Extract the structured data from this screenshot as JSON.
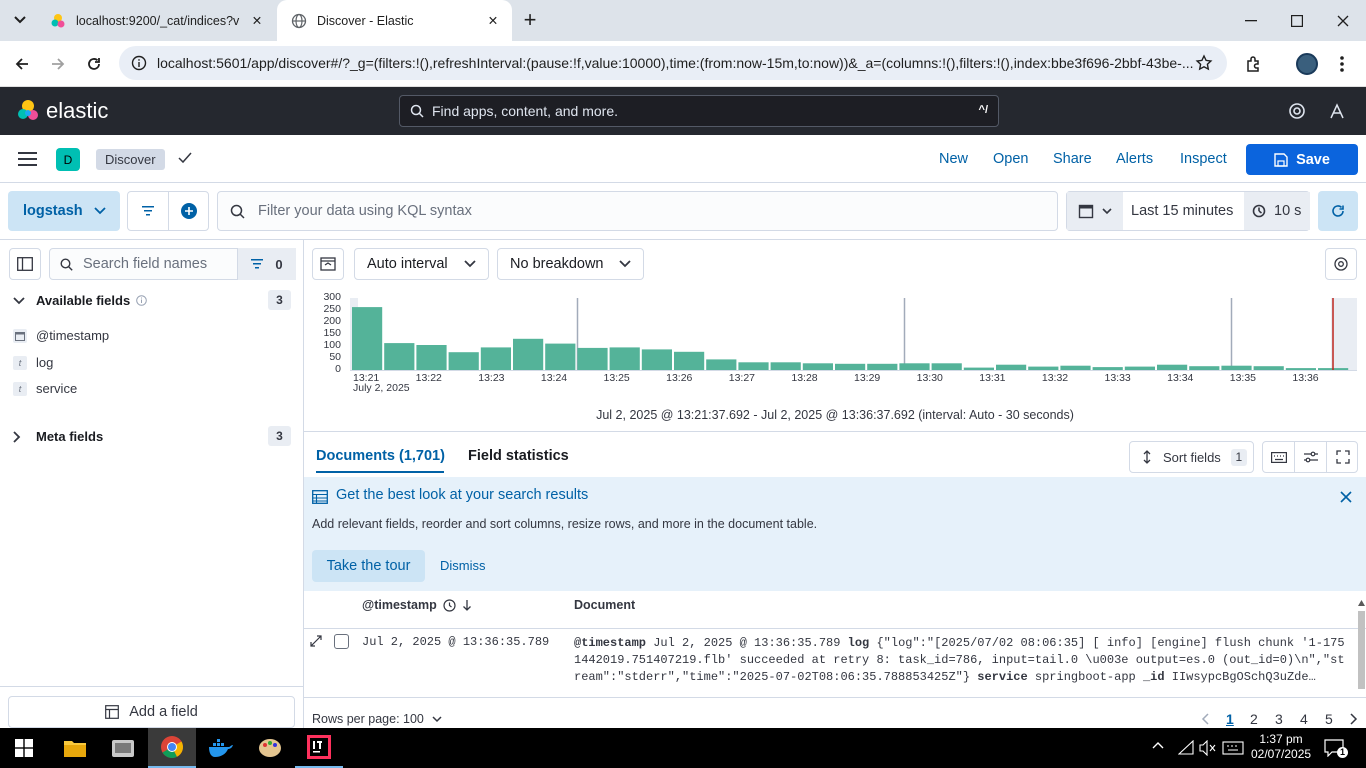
{
  "browser": {
    "tabs": [
      {
        "title": "localhost:9200/_cat/indices?v"
      },
      {
        "title": "Discover - Elastic"
      }
    ],
    "url": "localhost:5601/app/discover#/?_g=(filters:!(),refreshInterval:(pause:!f,value:10000),time:(from:now-15m,to:now))&_a=(columns:!(),filters:!(),index:bbe3f696-2bbf-43be-..."
  },
  "kibana": {
    "brand": "elastic",
    "global_search_placeholder": "Find apps, content, and more.",
    "global_search_shortcut": "^/",
    "space_initial": "D",
    "app_name": "Discover",
    "menu": [
      "New",
      "Open",
      "Share",
      "Alerts",
      "Inspect"
    ],
    "save_label": "Save"
  },
  "query_bar": {
    "data_view": "logstash",
    "kql_placeholder": "Filter your data using KQL syntax",
    "time_range": "Last 15 minutes",
    "refresh_interval": "10 s"
  },
  "sidebar": {
    "search_placeholder": "Search field names",
    "filter_count": "0",
    "available_label": "Available fields",
    "available_count": "3",
    "fields": [
      {
        "name": "@timestamp",
        "type": "date-icon"
      },
      {
        "name": "log",
        "type": "t"
      },
      {
        "name": "service",
        "type": "t"
      }
    ],
    "meta_label": "Meta fields",
    "meta_count": "3",
    "add_field_label": "Add a field"
  },
  "histogram_toolbar": {
    "interval": "Auto interval",
    "breakdown": "No breakdown"
  },
  "chart_data": {
    "type": "bar",
    "x_ticks": [
      "13:21",
      "13:22",
      "13:23",
      "13:24",
      "13:25",
      "13:26",
      "13:27",
      "13:28",
      "13:29",
      "13:30",
      "13:31",
      "13:32",
      "13:33",
      "13:34",
      "13:35",
      "13:36"
    ],
    "x_sublabel": "July 2, 2025",
    "y_ticks": [
      "300",
      "250",
      "200",
      "150",
      "100",
      "50",
      "0"
    ],
    "ylim": [
      0,
      300
    ],
    "values": [
      262,
      112,
      104,
      74,
      94,
      130,
      110,
      92,
      94,
      86,
      76,
      44,
      32,
      32,
      28,
      26,
      26,
      28,
      28,
      10,
      22,
      14,
      18,
      12,
      14,
      22,
      16,
      18,
      16,
      8,
      8
    ],
    "summary": "Jul 2, 2025 @ 13:21:37.692 - Jul 2, 2025 @ 13:36:37.692 (interval: Auto - 30 seconds)",
    "bar_color": "#54b399"
  },
  "docs": {
    "tab_documents": "Documents (1,701)",
    "tab_field_stats": "Field statistics",
    "sort_fields_label": "Sort fields",
    "sort_fields_count": "1",
    "callout_title": "Get the best look at your search results",
    "callout_text": "Add relevant fields, reorder and sort columns, resize rows, and more in the document table.",
    "callout_primary": "Take the tour",
    "callout_secondary": "Dismiss",
    "col_timestamp": "@timestamp",
    "col_document": "Document",
    "row_timestamp": "Jul 2, 2025 @ 13:36:35.789",
    "row_k1": "@timestamp",
    "row_v1": "Jul 2, 2025 @ 13:36:35.789",
    "row_k2": "log",
    "row_v2a": "{\"log\":\"[2025/07/02 08:06:35] [ info] [engine] flush chunk '1-175",
    "row_v2b": "1442019.751407219.flb' succeeded at retry 8: task_id=786, input=tail.0 \\u003e output=es.0 (out_id=0)\\n\",\"st",
    "row_v2c": "ream\":\"stderr\",\"time\":\"2025-07-02T08:06:35.788853425Z\"}",
    "row_k3": "service",
    "row_v3": "springboot-app",
    "row_k4": "_id",
    "row_v4": "IIwsypcBgOSchQ3uZde…",
    "rows_per_page": "Rows per page: 100",
    "pages": [
      "1",
      "2",
      "3",
      "4",
      "5"
    ]
  },
  "taskbar": {
    "time": "1:37 pm",
    "date": "02/07/2025",
    "notif_count": "1"
  }
}
